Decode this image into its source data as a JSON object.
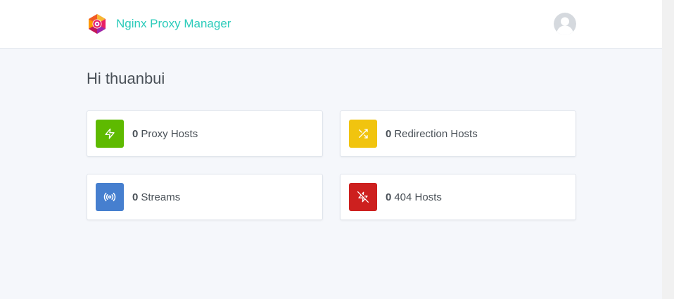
{
  "app": {
    "name": "Nginx Proxy Manager",
    "brand_color": "#2bcbba"
  },
  "user": {
    "greeting": "Hi thuanbui"
  },
  "cards": [
    {
      "count": "0",
      "label": "Proxy Hosts",
      "icon": "zap-icon",
      "color": "#5eba00"
    },
    {
      "count": "0",
      "label": "Redirection Hosts",
      "icon": "shuffle-icon",
      "color": "#f1c40f"
    },
    {
      "count": "0",
      "label": "Streams",
      "icon": "radio-icon",
      "color": "#467fcf"
    },
    {
      "count": "0",
      "label": "404 Hosts",
      "icon": "zap-off-icon",
      "color": "#cd201f"
    }
  ]
}
